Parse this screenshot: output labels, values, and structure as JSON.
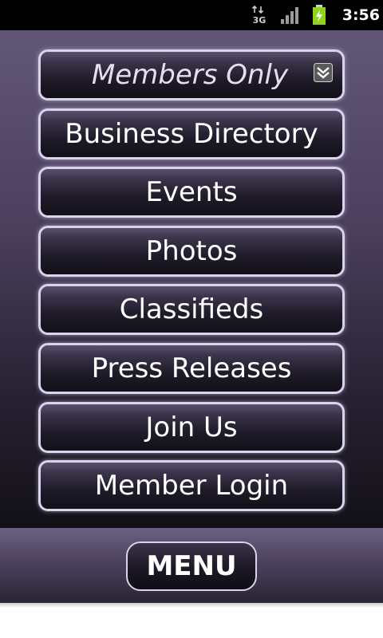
{
  "status_bar": {
    "network_label": "3G",
    "time": "3:56",
    "icons": [
      "network-3g-icon",
      "signal-icon",
      "battery-charging-icon"
    ],
    "battery_color": "#8fd31b"
  },
  "menu": {
    "dropdown": {
      "label": "Members Only",
      "icon": "chevron-down-icon"
    },
    "items": [
      "Business Directory",
      "Events",
      "Photos",
      "Classifieds",
      "Press Releases",
      "Join Us",
      "Member Login"
    ]
  },
  "bottom_bar": {
    "menu_label": "MENU"
  },
  "colors": {
    "background_top": "#625777",
    "background_bottom": "#121016",
    "button_border": "#d9d3ec",
    "status_bar": "#000000"
  }
}
